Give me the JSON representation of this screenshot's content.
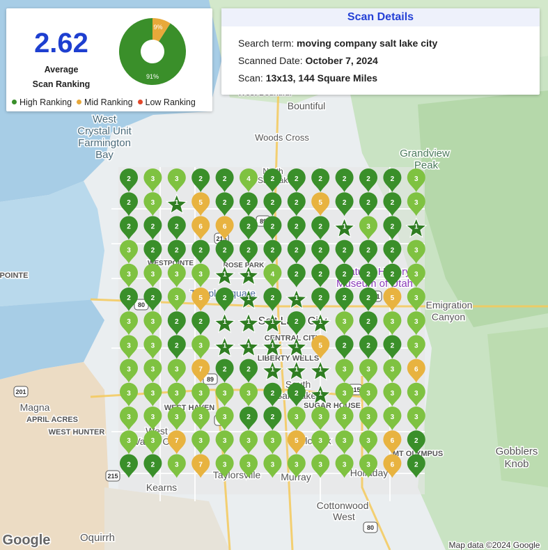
{
  "summary": {
    "average_value": "2.62",
    "average_label": "Average\nScan Ranking",
    "donut": {
      "high_pct": 91,
      "mid_pct": 9,
      "high_label": "91%",
      "mid_label": "9%"
    },
    "legend": [
      {
        "label": "High Ranking",
        "color": "#3a8f2a"
      },
      {
        "label": "Mid Ranking",
        "color": "#e8a93a"
      },
      {
        "label": "Low Ranking",
        "color": "#e2472a"
      }
    ]
  },
  "scan_details": {
    "title": "Scan Details",
    "search_term_label": "Search term:",
    "search_term_value": "moving company salt lake city",
    "date_label": "Scanned Date:",
    "date_value": "October 7, 2024",
    "scan_label": "Scan:",
    "scan_value": "13x13, 144 Square Miles"
  },
  "map_labels": [
    {
      "text": "West Bountiful"
    },
    {
      "text": "Bountiful"
    },
    {
      "text": "West"
    },
    {
      "text": "Crystal Unit"
    },
    {
      "text": "Farmington"
    },
    {
      "text": "Bay"
    },
    {
      "text": "Woods Cross"
    },
    {
      "text": "Grandview"
    },
    {
      "text": "Peak"
    },
    {
      "text": "North"
    },
    {
      "text": "Salt Lake"
    },
    {
      "text": "WESTPOINTE"
    },
    {
      "text": "ROSE PARK"
    },
    {
      "text": "POINTE"
    },
    {
      "text": "Natural History"
    },
    {
      "text": "Museum of Utah"
    },
    {
      "text": "Temple Square"
    },
    {
      "text": "Emigration"
    },
    {
      "text": "Canyon"
    },
    {
      "text": "Salt Lake City"
    },
    {
      "text": "CENTRAL CITY"
    },
    {
      "text": "LIBERTY WELLS"
    },
    {
      "text": "South"
    },
    {
      "text": "Salt Lake"
    },
    {
      "text": "SUGAR HOUSE"
    },
    {
      "text": "Magna"
    },
    {
      "text": "APRIL ACRES"
    },
    {
      "text": "WEST HAVEN"
    },
    {
      "text": "WEST HUNTER"
    },
    {
      "text": "West"
    },
    {
      "text": "Valley City"
    },
    {
      "text": "Millcreek"
    },
    {
      "text": "MT OLYMPUS"
    },
    {
      "text": "Gobblers"
    },
    {
      "text": "Knob"
    },
    {
      "text": "Kearns"
    },
    {
      "text": "Taylorsville"
    },
    {
      "text": "Murray"
    },
    {
      "text": "Holladay"
    },
    {
      "text": "Cottonwood"
    },
    {
      "text": "West"
    },
    {
      "text": "Oquirrh"
    },
    {
      "text": "Google"
    },
    {
      "text": "Map data ©2024 Google"
    }
  ],
  "route_shields": [
    "89",
    "215",
    "80",
    "201",
    "201",
    "89",
    "215",
    "85",
    "215",
    "80"
  ],
  "grid": {
    "ranks": [
      [
        2,
        3,
        3,
        2,
        2,
        4,
        2,
        2,
        2,
        2,
        2,
        2,
        3
      ],
      [
        2,
        3,
        1,
        5,
        2,
        2,
        2,
        2,
        5,
        2,
        2,
        2,
        3
      ],
      [
        2,
        2,
        2,
        6,
        6,
        2,
        2,
        2,
        2,
        1,
        3,
        2,
        1
      ],
      [
        3,
        2,
        2,
        2,
        2,
        2,
        2,
        2,
        2,
        2,
        2,
        2,
        3
      ],
      [
        3,
        3,
        3,
        3,
        1,
        1,
        4,
        2,
        2,
        2,
        2,
        2,
        3
      ],
      [
        2,
        2,
        3,
        5,
        2,
        1,
        2,
        1,
        2,
        2,
        2,
        5,
        3
      ],
      [
        3,
        3,
        2,
        2,
        1,
        1,
        1,
        2,
        1,
        3,
        2,
        3,
        3
      ],
      [
        3,
        3,
        2,
        3,
        1,
        1,
        1,
        1,
        5,
        2,
        2,
        2,
        3
      ],
      [
        3,
        3,
        3,
        7,
        2,
        2,
        1,
        1,
        1,
        3,
        3,
        3,
        6
      ],
      [
        3,
        3,
        3,
        3,
        3,
        3,
        2,
        2,
        1,
        3,
        3,
        3,
        3
      ],
      [
        3,
        3,
        3,
        3,
        3,
        2,
        2,
        3,
        3,
        3,
        3,
        3,
        3
      ],
      [
        3,
        3,
        7,
        3,
        3,
        3,
        3,
        5,
        3,
        3,
        3,
        6,
        2
      ],
      [
        2,
        2,
        3,
        7,
        3,
        3,
        3,
        3,
        3,
        3,
        3,
        6,
        2
      ]
    ],
    "colors": {
      "high": "#3a8f2a",
      "high_light": "#7fc241",
      "mid": "#e8b340",
      "star": "#2f7d22"
    }
  }
}
